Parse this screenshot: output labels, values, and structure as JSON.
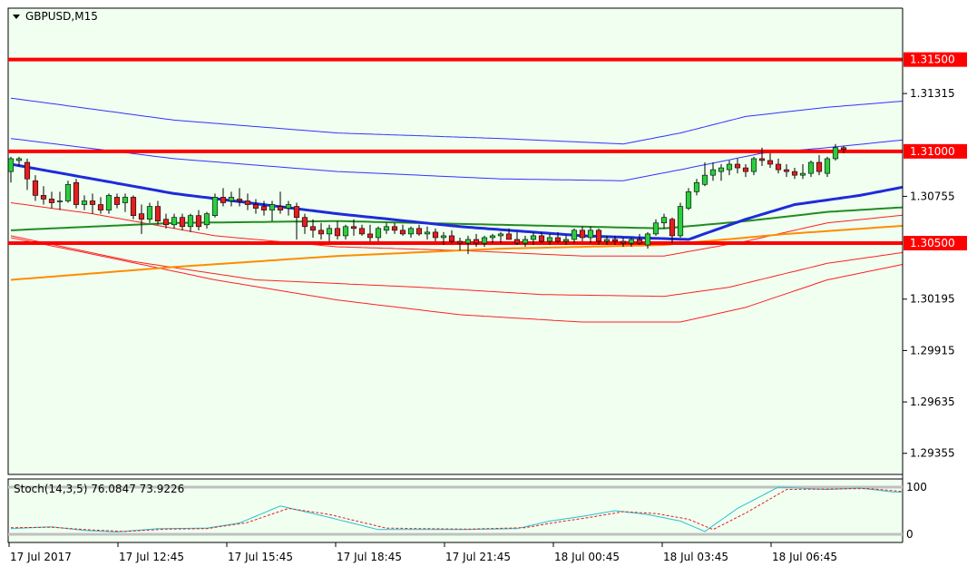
{
  "colors": {
    "background": "#f0fff0",
    "border": "#000000",
    "bull_candle": "#2ecc40",
    "bear_candle": "#e02020",
    "level_line": "#ff0000",
    "bollinger_outer": "#3232ff",
    "envelope_red": "#ff2020",
    "ma_blue": "#1e2bd8",
    "ma_green": "#228b22",
    "ma_orange": "#ff8c00",
    "stoch_main": "#2bbfd0",
    "stoch_signal": "#e02020",
    "stoch_level": "#c0c0c0"
  },
  "main_chart": {
    "title": "GBPUSD,M15",
    "title_icon": "triangle-down-icon",
    "ylim": [
      1.2924,
      1.3178
    ],
    "y_ticks": [
      "1.31315",
      "1.30755",
      "1.30195",
      "1.29915",
      "1.29635",
      "1.29355"
    ],
    "levels": [
      {
        "value": 1.315,
        "label": "1.31500"
      },
      {
        "value": 1.31,
        "label": "1.31000"
      },
      {
        "value": 1.305,
        "label": "1.30500"
      }
    ]
  },
  "stochastic": {
    "label": "Stoch(14,3,5) 76.0847 73.9226",
    "levels": [
      "100",
      "0"
    ],
    "ylim": [
      0,
      100
    ]
  },
  "x_axis": {
    "labels": [
      "17 Jul 2017",
      "17 Jul 12:45",
      "17 Jul 15:45",
      "17 Jul 18:45",
      "17 Jul 21:45",
      "18 Jul 00:45",
      "18 Jul 03:45",
      "18 Jul 06:45"
    ]
  },
  "chart_data": {
    "type": "candlestick",
    "symbol": "GBPUSD",
    "timeframe": "M15",
    "candles": [
      [
        1.3089,
        1.3097,
        1.3083,
        1.3096
      ],
      [
        1.3095,
        1.3097,
        1.3092,
        1.3096
      ],
      [
        1.3094,
        1.3096,
        1.3079,
        1.3085
      ],
      [
        1.3084,
        1.3087,
        1.3073,
        1.3076
      ],
      [
        1.3076,
        1.3081,
        1.3071,
        1.3074
      ],
      [
        1.3074,
        1.3078,
        1.3069,
        1.3072
      ],
      [
        1.3073,
        1.3078,
        1.3068,
        1.3073
      ],
      [
        1.3073,
        1.3084,
        1.3072,
        1.3082
      ],
      [
        1.3083,
        1.3085,
        1.3069,
        1.3071
      ],
      [
        1.3071,
        1.3076,
        1.3068,
        1.3073
      ],
      [
        1.3073,
        1.3077,
        1.3066,
        1.3071
      ],
      [
        1.3071,
        1.3075,
        1.3066,
        1.3068
      ],
      [
        1.3068,
        1.3077,
        1.3066,
        1.3076
      ],
      [
        1.3075,
        1.3077,
        1.3069,
        1.3071
      ],
      [
        1.3072,
        1.3077,
        1.3067,
        1.3075
      ],
      [
        1.3075,
        1.3076,
        1.3063,
        1.3065
      ],
      [
        1.3066,
        1.3071,
        1.3055,
        1.3063
      ],
      [
        1.3063,
        1.3072,
        1.3061,
        1.307
      ],
      [
        1.307,
        1.3073,
        1.306,
        1.3062
      ],
      [
        1.3063,
        1.3066,
        1.3058,
        1.306
      ],
      [
        1.306,
        1.3066,
        1.3058,
        1.3064
      ],
      [
        1.3064,
        1.3066,
        1.3057,
        1.3059
      ],
      [
        1.3059,
        1.3066,
        1.3056,
        1.3065
      ],
      [
        1.3065,
        1.3068,
        1.3057,
        1.3059
      ],
      [
        1.306,
        1.3067,
        1.3058,
        1.3066
      ],
      [
        1.3065,
        1.3077,
        1.3064,
        1.3075
      ],
      [
        1.3075,
        1.308,
        1.307,
        1.3072
      ],
      [
        1.3073,
        1.3078,
        1.307,
        1.3075
      ],
      [
        1.3074,
        1.308,
        1.307,
        1.3073
      ],
      [
        1.3073,
        1.3077,
        1.3068,
        1.3071
      ],
      [
        1.3071,
        1.3074,
        1.3066,
        1.3069
      ],
      [
        1.307,
        1.3073,
        1.3065,
        1.3068
      ],
      [
        1.3068,
        1.3073,
        1.3062,
        1.3071
      ],
      [
        1.307,
        1.3078,
        1.3066,
        1.3068
      ],
      [
        1.3069,
        1.3073,
        1.3065,
        1.3071
      ],
      [
        1.307,
        1.3072,
        1.3052,
        1.3064
      ],
      [
        1.3064,
        1.3066,
        1.3055,
        1.3059
      ],
      [
        1.3059,
        1.3063,
        1.3053,
        1.3057
      ],
      [
        1.3057,
        1.3061,
        1.3052,
        1.3055
      ],
      [
        1.3055,
        1.306,
        1.3051,
        1.3058
      ],
      [
        1.3058,
        1.3062,
        1.3052,
        1.3054
      ],
      [
        1.3054,
        1.306,
        1.3052,
        1.3059
      ],
      [
        1.3059,
        1.3063,
        1.3054,
        1.3058
      ],
      [
        1.3058,
        1.306,
        1.3054,
        1.3055
      ],
      [
        1.3055,
        1.306,
        1.3051,
        1.3053
      ],
      [
        1.3053,
        1.3059,
        1.3051,
        1.3058
      ],
      [
        1.3057,
        1.3061,
        1.3055,
        1.3059
      ],
      [
        1.3059,
        1.3061,
        1.3055,
        1.3057
      ],
      [
        1.3057,
        1.306,
        1.3054,
        1.3055
      ],
      [
        1.3055,
        1.3059,
        1.3053,
        1.3058
      ],
      [
        1.3058,
        1.306,
        1.3054,
        1.3055
      ],
      [
        1.3055,
        1.3059,
        1.3052,
        1.3056
      ],
      [
        1.3056,
        1.3058,
        1.3051,
        1.3053
      ],
      [
        1.3053,
        1.3056,
        1.3049,
        1.3054
      ],
      [
        1.3054,
        1.3057,
        1.305,
        1.3051
      ],
      [
        1.3051,
        1.3053,
        1.3046,
        1.305
      ],
      [
        1.305,
        1.3054,
        1.3044,
        1.3052
      ],
      [
        1.3052,
        1.3055,
        1.3048,
        1.305
      ],
      [
        1.305,
        1.3054,
        1.3048,
        1.3053
      ],
      [
        1.3053,
        1.3055,
        1.305,
        1.3054
      ],
      [
        1.3054,
        1.3056,
        1.305,
        1.3055
      ],
      [
        1.3055,
        1.3058,
        1.3052,
        1.3052
      ],
      [
        1.3052,
        1.3056,
        1.3049,
        1.305
      ],
      [
        1.305,
        1.3054,
        1.3048,
        1.3052
      ],
      [
        1.3052,
        1.3056,
        1.3049,
        1.3054
      ],
      [
        1.3054,
        1.3056,
        1.305,
        1.3051
      ],
      [
        1.3051,
        1.3055,
        1.3049,
        1.3053
      ],
      [
        1.3053,
        1.3056,
        1.305,
        1.3051
      ],
      [
        1.3051,
        1.3054,
        1.3049,
        1.3052
      ],
      [
        1.3052,
        1.3058,
        1.305,
        1.3057
      ],
      [
        1.3057,
        1.3059,
        1.3051,
        1.3053
      ],
      [
        1.3053,
        1.3059,
        1.305,
        1.3057
      ],
      [
        1.3057,
        1.3058,
        1.3049,
        1.3051
      ],
      [
        1.3051,
        1.3054,
        1.3049,
        1.3052
      ],
      [
        1.3052,
        1.3054,
        1.3049,
        1.3051
      ],
      [
        1.3051,
        1.3053,
        1.3048,
        1.305
      ],
      [
        1.305,
        1.3053,
        1.3048,
        1.3052
      ],
      [
        1.3052,
        1.3055,
        1.3049,
        1.305
      ],
      [
        1.3049,
        1.3056,
        1.3047,
        1.3055
      ],
      [
        1.3055,
        1.3063,
        1.3054,
        1.3061
      ],
      [
        1.3061,
        1.3066,
        1.3058,
        1.3064
      ],
      [
        1.3063,
        1.3064,
        1.305,
        1.3054
      ],
      [
        1.3054,
        1.3072,
        1.3053,
        1.307
      ],
      [
        1.3069,
        1.308,
        1.3068,
        1.3078
      ],
      [
        1.3078,
        1.3085,
        1.3076,
        1.3083
      ],
      [
        1.3082,
        1.3094,
        1.3081,
        1.3087
      ],
      [
        1.3087,
        1.3094,
        1.3084,
        1.309
      ],
      [
        1.3089,
        1.3093,
        1.3084,
        1.3091
      ],
      [
        1.309,
        1.3095,
        1.3087,
        1.3093
      ],
      [
        1.3093,
        1.3096,
        1.3088,
        1.3091
      ],
      [
        1.3091,
        1.3093,
        1.3086,
        1.3089
      ],
      [
        1.3089,
        1.3097,
        1.3087,
        1.3096
      ],
      [
        1.3096,
        1.3102,
        1.3092,
        1.3095
      ],
      [
        1.3095,
        1.3099,
        1.3091,
        1.3093
      ],
      [
        1.3093,
        1.3096,
        1.3088,
        1.309
      ],
      [
        1.309,
        1.3093,
        1.3086,
        1.3089
      ],
      [
        1.3089,
        1.3091,
        1.3085,
        1.3087
      ],
      [
        1.3087,
        1.3093,
        1.3085,
        1.3088
      ],
      [
        1.3088,
        1.3095,
        1.3086,
        1.3094
      ],
      [
        1.3094,
        1.3098,
        1.3087,
        1.3089
      ],
      [
        1.3088,
        1.3097,
        1.3086,
        1.3096
      ],
      [
        1.3096,
        1.3104,
        1.3095,
        1.3102
      ],
      [
        1.3102,
        1.3103,
        1.3099,
        1.3101
      ]
    ],
    "indicators": {
      "bollinger_upper": [
        [
          0,
          1.3129
        ],
        [
          20,
          1.3117
        ],
        [
          40,
          1.311
        ],
        [
          60,
          1.3107
        ],
        [
          75,
          1.3104
        ],
        [
          82,
          1.311
        ],
        [
          90,
          1.3119
        ],
        [
          100,
          1.3124
        ],
        [
          111,
          1.3128
        ]
      ],
      "bollinger_middle_upper": [
        [
          0,
          1.3107
        ],
        [
          20,
          1.3096
        ],
        [
          40,
          1.3089
        ],
        [
          60,
          1.3085
        ],
        [
          75,
          1.3084
        ],
        [
          82,
          1.309
        ],
        [
          92,
          1.3099
        ],
        [
          100,
          1.3102
        ],
        [
          111,
          1.3107
        ]
      ],
      "ma_blue": [
        [
          0,
          1.3093
        ],
        [
          20,
          1.3077
        ],
        [
          40,
          1.3066
        ],
        [
          55,
          1.3059
        ],
        [
          70,
          1.3054
        ],
        [
          83,
          1.3052
        ],
        [
          90,
          1.3063
        ],
        [
          96,
          1.3071
        ],
        [
          104,
          1.3076
        ],
        [
          111,
          1.3082
        ]
      ],
      "ma_green": [
        [
          0,
          1.3057
        ],
        [
          20,
          1.3061
        ],
        [
          40,
          1.3062
        ],
        [
          60,
          1.306
        ],
        [
          80,
          1.3058
        ],
        [
          90,
          1.3062
        ],
        [
          100,
          1.3067
        ],
        [
          111,
          1.307
        ]
      ],
      "ma_orange": [
        [
          0,
          1.303
        ],
        [
          20,
          1.3037
        ],
        [
          40,
          1.3043
        ],
        [
          60,
          1.3047
        ],
        [
          80,
          1.3049
        ],
        [
          95,
          1.3055
        ],
        [
          111,
          1.306
        ]
      ],
      "envelope_red_upper": [
        [
          0,
          1.3072
        ],
        [
          10,
          1.3066
        ],
        [
          25,
          1.3054
        ],
        [
          40,
          1.3048
        ],
        [
          55,
          1.3046
        ],
        [
          70,
          1.3043
        ],
        [
          80,
          1.3043
        ],
        [
          90,
          1.3051
        ],
        [
          100,
          1.3061
        ],
        [
          111,
          1.3066
        ]
      ],
      "envelope_red_middle": [
        [
          0,
          1.3054
        ],
        [
          15,
          1.304
        ],
        [
          30,
          1.303
        ],
        [
          50,
          1.3026
        ],
        [
          65,
          1.3022
        ],
        [
          80,
          1.3021
        ],
        [
          88,
          1.3026
        ],
        [
          100,
          1.3039
        ],
        [
          111,
          1.3046
        ]
      ],
      "envelope_red_lower": [
        [
          0,
          1.3053
        ],
        [
          10,
          1.3044
        ],
        [
          25,
          1.303
        ],
        [
          40,
          1.3019
        ],
        [
          55,
          1.3011
        ],
        [
          70,
          1.3007
        ],
        [
          82,
          1.3007
        ],
        [
          90,
          1.3015
        ],
        [
          100,
          1.303
        ],
        [
          111,
          1.304
        ]
      ]
    },
    "stochastic": {
      "main": [
        [
          0,
          12
        ],
        [
          5,
          16
        ],
        [
          9,
          8
        ],
        [
          13,
          5
        ],
        [
          18,
          12
        ],
        [
          24,
          13
        ],
        [
          28,
          24
        ],
        [
          33,
          60
        ],
        [
          38,
          40
        ],
        [
          45,
          10
        ],
        [
          55,
          10
        ],
        [
          62,
          12
        ],
        [
          66,
          28
        ],
        [
          70,
          38
        ],
        [
          74,
          50
        ],
        [
          78,
          42
        ],
        [
          82,
          28
        ],
        [
          85,
          6
        ],
        [
          89,
          55
        ],
        [
          94,
          100
        ],
        [
          100,
          95
        ],
        [
          104,
          98
        ],
        [
          108,
          90
        ],
        [
          111,
          88
        ]
      ],
      "signal": [
        [
          0,
          14
        ],
        [
          5,
          15
        ],
        [
          10,
          9
        ],
        [
          14,
          6
        ],
        [
          19,
          11
        ],
        [
          24,
          12
        ],
        [
          29,
          25
        ],
        [
          34,
          55
        ],
        [
          39,
          42
        ],
        [
          46,
          13
        ],
        [
          56,
          11
        ],
        [
          63,
          14
        ],
        [
          67,
          26
        ],
        [
          71,
          36
        ],
        [
          75,
          48
        ],
        [
          79,
          44
        ],
        [
          83,
          32
        ],
        [
          86,
          10
        ],
        [
          90,
          45
        ],
        [
          95,
          95
        ],
        [
          100,
          96
        ],
        [
          105,
          97
        ],
        [
          109,
          91
        ],
        [
          111,
          89
        ]
      ]
    }
  }
}
